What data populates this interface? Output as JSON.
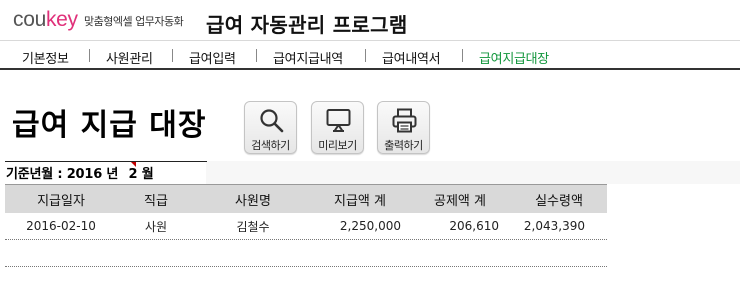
{
  "header": {
    "logo_part1": "cou",
    "logo_part2": "key",
    "logo_sub": "맞춤형엑셀 업무자동화",
    "app_title": "급여 자동관리 프로그램"
  },
  "nav": {
    "items": [
      {
        "label": "기본정보"
      },
      {
        "label": "사원관리"
      },
      {
        "label": "급여입력"
      },
      {
        "label": "급여지급내역"
      },
      {
        "label": "급여내역서"
      },
      {
        "label": "급여지급대장"
      }
    ]
  },
  "page": {
    "title": "급여 지급 대장"
  },
  "toolbar": {
    "search_label": "검색하기",
    "preview_label": "미리보기",
    "print_label": "출력하기"
  },
  "base": {
    "label": "기준년월 :",
    "year": "2016",
    "year_unit": "년",
    "month": "2",
    "month_unit": "월"
  },
  "table": {
    "columns": [
      "지급일자",
      "직급",
      "사원명",
      "지급액 계",
      "공제액 계",
      "실수령액"
    ],
    "rows": [
      {
        "date": "2016-02-10",
        "rank": "사원",
        "name": "김철수",
        "pay": "2,250,000",
        "deduction": "206,610",
        "net": "2,043,390"
      }
    ]
  },
  "colors": {
    "logo_gray": "#555555",
    "logo_pink": "#e0307a",
    "nav_active": "#12963c",
    "table_header_bg": "#d9d9d9"
  }
}
